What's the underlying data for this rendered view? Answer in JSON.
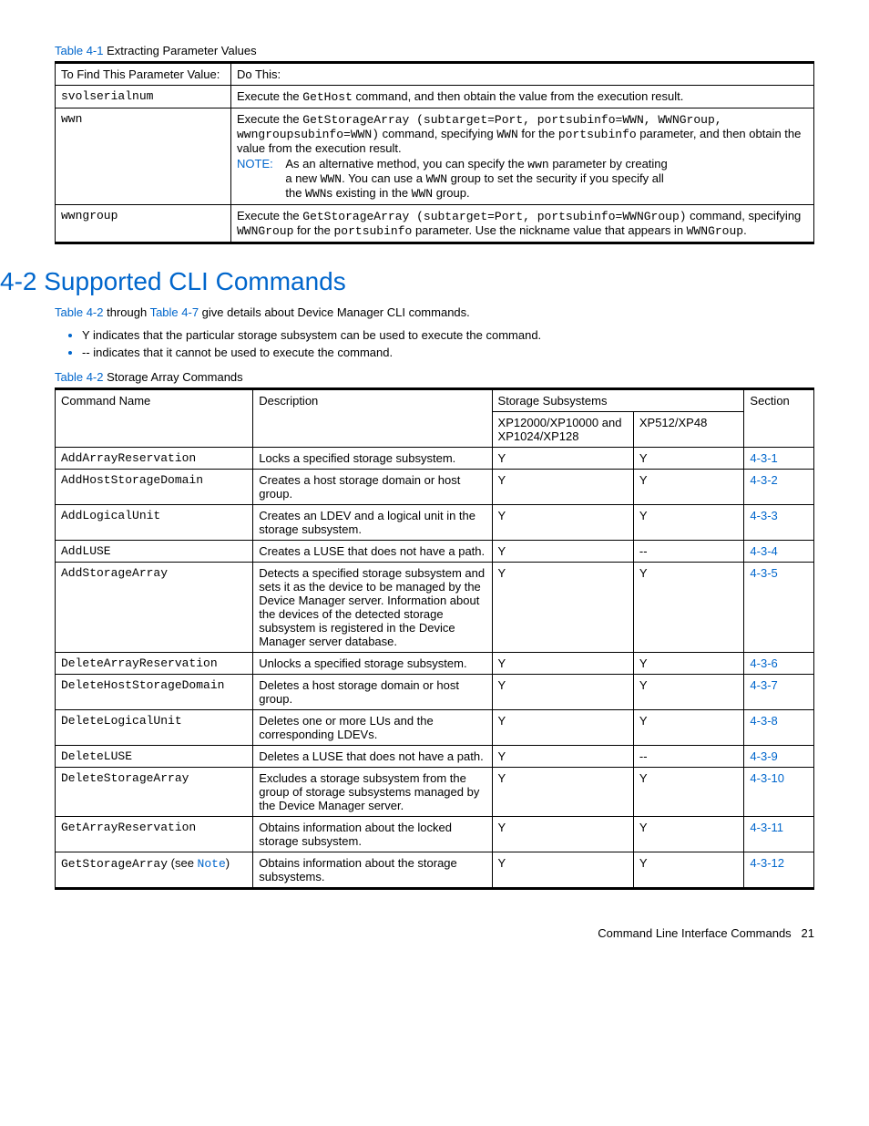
{
  "table41": {
    "caption_link": "Table 4-1",
    "caption_rest": "  Extracting Parameter Values",
    "h1": "To Find This Parameter Value:",
    "h2": "Do This:",
    "r1c1": "svolserialnum",
    "r1_a": "Execute the ",
    "r1_b": "GetHost",
    "r1_c": " command, and then obtain the value from the execution result.",
    "r2c1": "wwn",
    "r2_a": "Execute the ",
    "r2_b": "GetStorageArray (subtarget=Port, portsubinfo=WWN, WWNGroup, wwngroupsubinfo=WWN)",
    "r2_c": " command, specifying ",
    "r2_d": "WWN",
    "r2_e": " for the ",
    "r2_f": "portsubinfo",
    "r2_g": " parameter, and then obtain the value from the execution result.",
    "note_label": "NOTE:",
    "r2_note_a": "As an alternative method, you can specify the ",
    "r2_note_b": "wwn",
    "r2_note_c": " parameter by creating a new ",
    "r2_note_d": "WWN",
    "r2_note_e": ". You can use a ",
    "r2_note_f": "WWN",
    "r2_note_g": " group to set the security if you specify all the ",
    "r2_note_h": "WWN",
    "r2_note_i": "s existing in the ",
    "r2_note_j": "WWN",
    "r2_note_k": " group.",
    "r3c1": "wwngroup",
    "r3_a": "Execute the ",
    "r3_b": "GetStorageArray (subtarget=Port, portsubinfo=WWNGroup)",
    "r3_c": " command, specifying ",
    "r3_d": "WWNGroup",
    "r3_e": " for the ",
    "r3_f": "portsubinfo",
    "r3_g": " parameter. Use the nickname value that appears in ",
    "r3_h": "WWNGroup",
    "r3_i": "."
  },
  "heading": "4-2 Supported CLI Commands",
  "intro_a": "Table 4-2",
  "intro_b": " through ",
  "intro_c": "Table 4-7",
  "intro_d": " give details about Device Manager CLI commands.",
  "bullet1": "Y indicates that the particular storage subsystem can be used to execute the command.",
  "bullet2": "-- indicates that it cannot be used to execute the command.",
  "table42": {
    "caption_link": "Table 4-2",
    "caption_rest": "  Storage Array Commands",
    "h_cmd": "Command Name",
    "h_desc": "Description",
    "h_sub": "Storage Subsystems",
    "h_sec": "Section",
    "h_sub1": "XP12000/XP10000 and XP1024/XP128",
    "h_sub2": "XP512/XP48",
    "rows": [
      {
        "cmd": "AddArrayReservation",
        "note": "",
        "desc": "Locks a specified storage subsystem.",
        "s1": "Y",
        "s2": "Y",
        "sec": "4-3-1"
      },
      {
        "cmd": "AddHostStorageDomain",
        "note": "",
        "desc": "Creates a host storage domain or host group.",
        "s1": "Y",
        "s2": "Y",
        "sec": "4-3-2"
      },
      {
        "cmd": "AddLogicalUnit",
        "note": "",
        "desc": "Creates an LDEV and a logical unit in the storage subsystem.",
        "s1": "Y",
        "s2": "Y",
        "sec": "4-3-3"
      },
      {
        "cmd": "AddLUSE",
        "note": "",
        "desc": "Creates a LUSE that does not have a path.",
        "s1": "Y",
        "s2": "--",
        "sec": "4-3-4"
      },
      {
        "cmd": "AddStorageArray",
        "note": "",
        "desc": "Detects a specified storage subsystem and sets it as the device to be managed by the Device Manager server. Information about the devices of the detected storage subsystem is registered in the Device Manager server database.",
        "s1": "Y",
        "s2": "Y",
        "sec": "4-3-5"
      },
      {
        "cmd": "DeleteArrayReservation",
        "note": "",
        "desc": "Unlocks a specified storage subsystem.",
        "s1": "Y",
        "s2": "Y",
        "sec": "4-3-6"
      },
      {
        "cmd": "DeleteHostStorageDomain",
        "note": "",
        "desc": "Deletes a host storage domain or host group.",
        "s1": "Y",
        "s2": "Y",
        "sec": "4-3-7"
      },
      {
        "cmd": "DeleteLogicalUnit",
        "note": "",
        "desc": "Deletes one or more LUs and the corresponding LDEVs.",
        "s1": "Y",
        "s2": "Y",
        "sec": "4-3-8"
      },
      {
        "cmd": "DeleteLUSE",
        "note": "",
        "desc": "Deletes a LUSE that does not have a path.",
        "s1": "Y",
        "s2": "--",
        "sec": "4-3-9"
      },
      {
        "cmd": "DeleteStorageArray",
        "note": "",
        "desc": "Excludes a storage subsystem from the group of storage subsystems managed by the Device Manager server.",
        "s1": "Y",
        "s2": "Y",
        "sec": "4-3-10"
      },
      {
        "cmd": "GetArrayReservation",
        "note": "",
        "desc": "Obtains information about the locked storage subsystem.",
        "s1": "Y",
        "s2": "Y",
        "sec": "4-3-11"
      },
      {
        "cmd": "GetStorageArray",
        "note": "Note",
        "desc": "Obtains information about the storage subsystems.",
        "s1": "Y",
        "s2": "Y",
        "sec": "4-3-12"
      }
    ],
    "see_prefix": " (see ",
    "see_suffix": ")"
  },
  "footer_a": "Command Line Interface Commands",
  "footer_b": "21"
}
